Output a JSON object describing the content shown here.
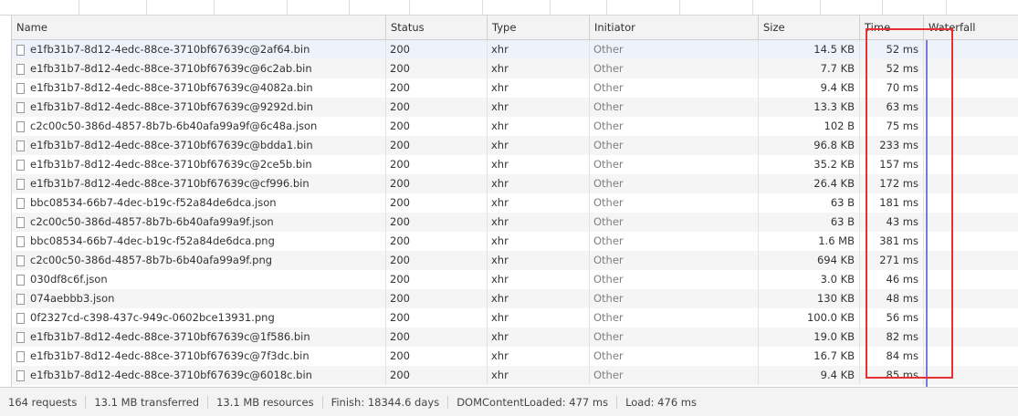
{
  "columns": {
    "name": "Name",
    "status": "Status",
    "type": "Type",
    "initiator": "Initiator",
    "size": "Size",
    "time": "Time",
    "waterfall": "Waterfall"
  },
  "rows": [
    {
      "name": "e1fb31b7-8d12-4edc-88ce-3710bf67639c@2af64.bin",
      "status": "200",
      "type": "xhr",
      "initiator": "Other",
      "size": "14.5 KB",
      "time": "52 ms"
    },
    {
      "name": "e1fb31b7-8d12-4edc-88ce-3710bf67639c@6c2ab.bin",
      "status": "200",
      "type": "xhr",
      "initiator": "Other",
      "size": "7.7 KB",
      "time": "52 ms"
    },
    {
      "name": "e1fb31b7-8d12-4edc-88ce-3710bf67639c@4082a.bin",
      "status": "200",
      "type": "xhr",
      "initiator": "Other",
      "size": "9.4 KB",
      "time": "70 ms"
    },
    {
      "name": "e1fb31b7-8d12-4edc-88ce-3710bf67639c@9292d.bin",
      "status": "200",
      "type": "xhr",
      "initiator": "Other",
      "size": "13.3 KB",
      "time": "63 ms"
    },
    {
      "name": "c2c00c50-386d-4857-8b7b-6b40afa99a9f@6c48a.json",
      "status": "200",
      "type": "xhr",
      "initiator": "Other",
      "size": "102 B",
      "time": "75 ms"
    },
    {
      "name": "e1fb31b7-8d12-4edc-88ce-3710bf67639c@bdda1.bin",
      "status": "200",
      "type": "xhr",
      "initiator": "Other",
      "size": "96.8 KB",
      "time": "233 ms"
    },
    {
      "name": "e1fb31b7-8d12-4edc-88ce-3710bf67639c@2ce5b.bin",
      "status": "200",
      "type": "xhr",
      "initiator": "Other",
      "size": "35.2 KB",
      "time": "157 ms"
    },
    {
      "name": "e1fb31b7-8d12-4edc-88ce-3710bf67639c@cf996.bin",
      "status": "200",
      "type": "xhr",
      "initiator": "Other",
      "size": "26.4 KB",
      "time": "172 ms"
    },
    {
      "name": "bbc08534-66b7-4dec-b19c-f52a84de6dca.json",
      "status": "200",
      "type": "xhr",
      "initiator": "Other",
      "size": "63 B",
      "time": "181 ms"
    },
    {
      "name": "c2c00c50-386d-4857-8b7b-6b40afa99a9f.json",
      "status": "200",
      "type": "xhr",
      "initiator": "Other",
      "size": "63 B",
      "time": "43 ms"
    },
    {
      "name": "bbc08534-66b7-4dec-b19c-f52a84de6dca.png",
      "status": "200",
      "type": "xhr",
      "initiator": "Other",
      "size": "1.6 MB",
      "time": "381 ms"
    },
    {
      "name": "c2c00c50-386d-4857-8b7b-6b40afa99a9f.png",
      "status": "200",
      "type": "xhr",
      "initiator": "Other",
      "size": "694 KB",
      "time": "271 ms"
    },
    {
      "name": "030df8c6f.json",
      "status": "200",
      "type": "xhr",
      "initiator": "Other",
      "size": "3.0 KB",
      "time": "46 ms"
    },
    {
      "name": "074aebbb3.json",
      "status": "200",
      "type": "xhr",
      "initiator": "Other",
      "size": "130 KB",
      "time": "48 ms"
    },
    {
      "name": "0f2327cd-c398-437c-949c-0602bce13931.png",
      "status": "200",
      "type": "xhr",
      "initiator": "Other",
      "size": "100.0 KB",
      "time": "56 ms"
    },
    {
      "name": "e1fb31b7-8d12-4edc-88ce-3710bf67639c@1f586.bin",
      "status": "200",
      "type": "xhr",
      "initiator": "Other",
      "size": "19.0 KB",
      "time": "82 ms"
    },
    {
      "name": "e1fb31b7-8d12-4edc-88ce-3710bf67639c@7f3dc.bin",
      "status": "200",
      "type": "xhr",
      "initiator": "Other",
      "size": "16.7 KB",
      "time": "84 ms"
    },
    {
      "name": "e1fb31b7-8d12-4edc-88ce-3710bf67639c@6018c.bin",
      "status": "200",
      "type": "xhr",
      "initiator": "Other",
      "size": "9.4 KB",
      "time": "85 ms"
    }
  ],
  "status_bar": {
    "requests": "164 requests",
    "transferred": "13.1 MB transferred",
    "resources": "13.1 MB resources",
    "finish": "Finish: 18344.6 days",
    "dom_content_loaded": "DOMContentLoaded: 477 ms",
    "load": "Load: 476 ms"
  },
  "colors": {
    "highlight_box": "#e8312f",
    "dom_content_loaded": "#1a5fb4",
    "load": "#c0392b",
    "waterfall_marker": "#7a7ad6"
  },
  "icons": {
    "row_icon": "file-icon"
  }
}
